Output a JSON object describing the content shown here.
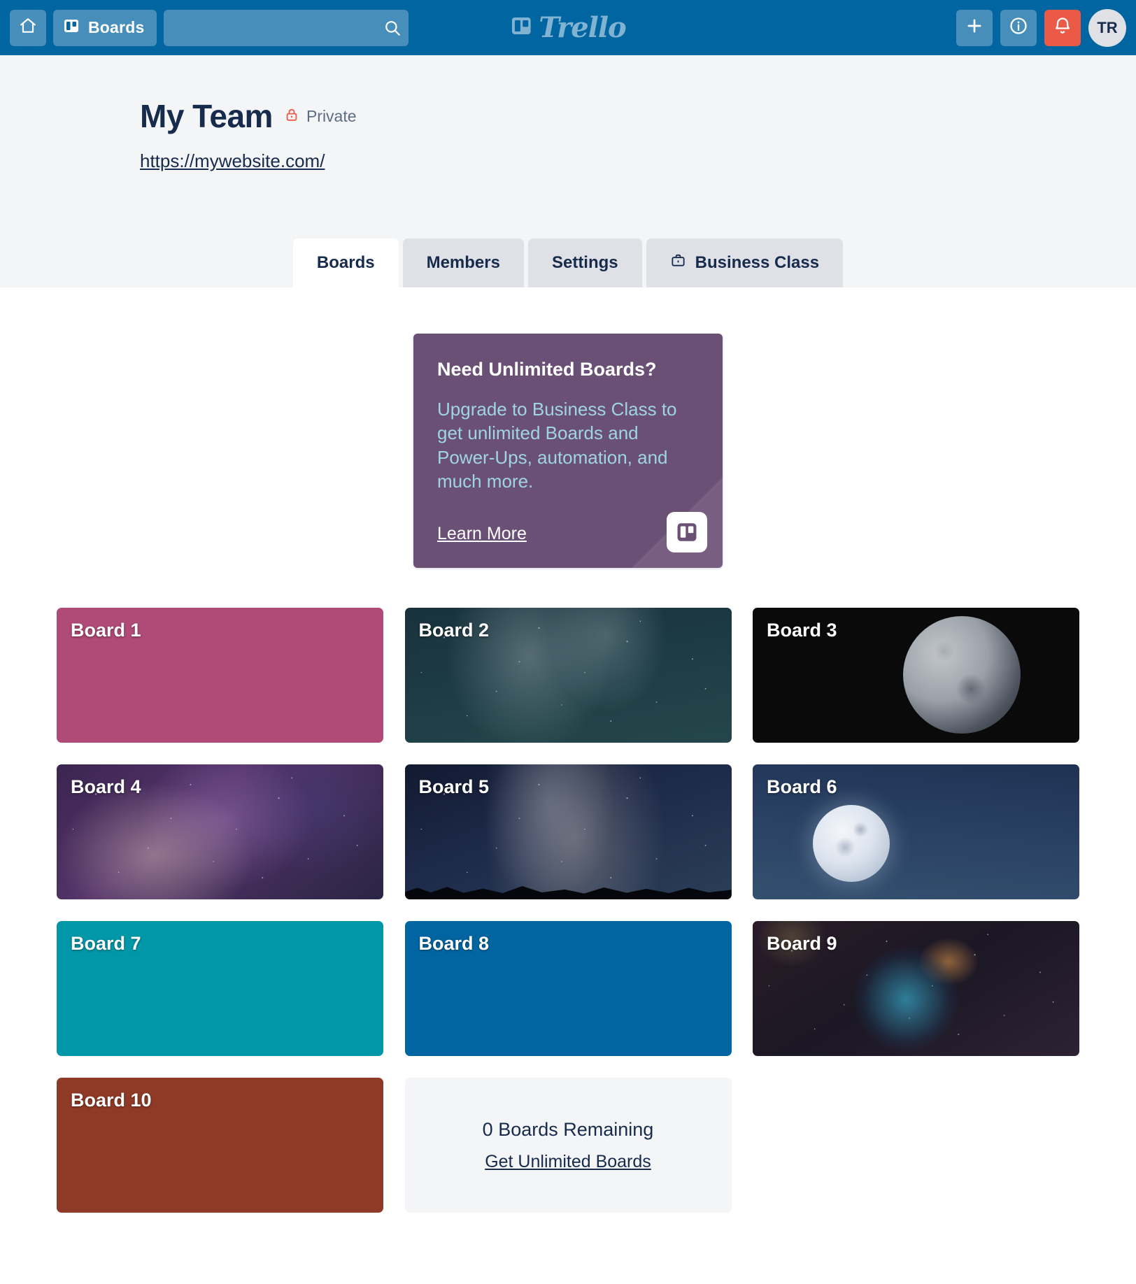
{
  "topnav": {
    "home_icon": "home-icon",
    "boards_button": "Boards",
    "search_placeholder": "",
    "search_value": "",
    "search_icon": "search-icon",
    "brand": "Trello",
    "add_icon": "plus-icon",
    "info_icon": "info-icon",
    "notifications_icon": "bell-icon",
    "avatar_initials": "TR",
    "colors": {
      "bar": "#0065a0",
      "button": "rgba(255,255,255,0.28)",
      "alert": "#eb5a46",
      "avatar_bg": "#dfe1e6"
    }
  },
  "team": {
    "name": "My Team",
    "visibility": "Private",
    "lock_icon": "lock-icon",
    "url": "https://mywebsite.com/",
    "lock_color": "#eb5a46"
  },
  "tabs": [
    {
      "label": "Boards",
      "active": true,
      "icon": null
    },
    {
      "label": "Members",
      "active": false,
      "icon": null
    },
    {
      "label": "Settings",
      "active": false,
      "icon": null
    },
    {
      "label": "Business Class",
      "active": false,
      "icon": "briefcase-icon"
    }
  ],
  "promo": {
    "title": "Need Unlimited Boards?",
    "body": "Upgrade to Business Class to get unlimited Boards and Power-Ups, automation, and much more.",
    "link": "Learn More",
    "logo_icon": "trello-logo-icon",
    "bg_color": "#6b5075",
    "body_color": "#9fd4e3"
  },
  "boards": [
    {
      "title": "Board 1",
      "style": "bg-solid-pink",
      "color": "#b04a77",
      "kind": "color"
    },
    {
      "title": "Board 2",
      "style": "bg-stars-teal",
      "color": "#1d3b45",
      "kind": "photo-milkyway"
    },
    {
      "title": "Board 3",
      "style": "bg-black",
      "color": "#0a0a0a",
      "kind": "photo-moon-dark"
    },
    {
      "title": "Board 4",
      "style": "bg-nebula-purple",
      "color": "#54336a",
      "kind": "photo-nebula"
    },
    {
      "title": "Board 5",
      "style": "bg-stars-milky",
      "color": "#1d2a4a",
      "kind": "photo-milkyway-trees"
    },
    {
      "title": "Board 6",
      "style": "bg-night-blue",
      "color": "#2b4365",
      "kind": "photo-moon-blue"
    },
    {
      "title": "Board 7",
      "style": "bg-solid-teal",
      "color": "#0098a8",
      "kind": "color"
    },
    {
      "title": "Board 8",
      "style": "bg-solid-blue",
      "color": "#0065a0",
      "kind": "color"
    },
    {
      "title": "Board 9",
      "style": "bg-nebula-bubble",
      "color": "#2d2233",
      "kind": "photo-bubble-nebula"
    },
    {
      "title": "Board 10",
      "style": "bg-solid-rust",
      "color": "#8f3a26",
      "kind": "color"
    }
  ],
  "remaining": {
    "count_text": "0 Boards Remaining",
    "link": "Get Unlimited Boards"
  }
}
